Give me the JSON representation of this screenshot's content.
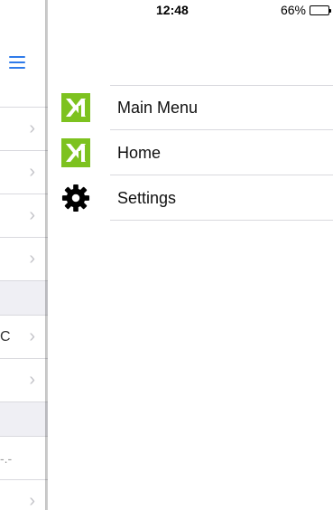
{
  "status": {
    "time": "12:48",
    "battery_pct_text": "66%",
    "battery_level": 0.66
  },
  "under": {
    "fragments": [
      "C",
      "-.-"
    ]
  },
  "menu": {
    "items": [
      {
        "label": "Main Menu",
        "icon": "brand-logo-icon"
      },
      {
        "label": "Home",
        "icon": "brand-logo-icon"
      },
      {
        "label": "Settings",
        "icon": "gear-icon"
      }
    ]
  },
  "colors": {
    "accent_blue": "#2f7bea",
    "logo_green": "#7dc21f",
    "separator": "#d9d9de"
  }
}
